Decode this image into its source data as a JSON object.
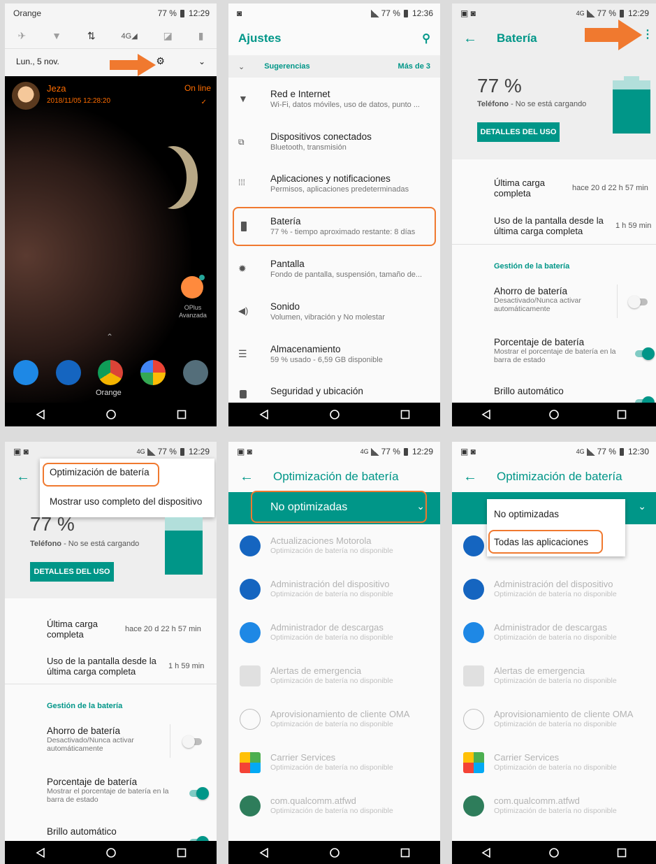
{
  "p1": {
    "carrier": "Orange",
    "battery": "77 %",
    "time": "12:29",
    "date": "Lun., 5 nov.",
    "notif_name": "Jeza",
    "notif_time": "2018/11/05 12:28:20",
    "notif_status": "On line",
    "app_label_1": "OPlus",
    "app_label_2": "Avanzada",
    "dock_label": "Orange"
  },
  "p2": {
    "time": "12:36",
    "battery": "77 %",
    "title": "Ajustes",
    "sugg_label": "Sugerencias",
    "sugg_more": "Más de 3",
    "items": [
      {
        "title": "Red e Internet",
        "sub": "Wi-Fi, datos móviles, uso de datos, punto ..."
      },
      {
        "title": "Dispositivos conectados",
        "sub": "Bluetooth, transmisión"
      },
      {
        "title": "Aplicaciones y notificaciones",
        "sub": "Permisos, aplicaciones predeterminadas"
      },
      {
        "title": "Batería",
        "sub": "77 % - tiempo aproximado restante: 8 días"
      },
      {
        "title": "Pantalla",
        "sub": "Fondo de pantalla, suspensión, tamaño de..."
      },
      {
        "title": "Sonido",
        "sub": "Volumen, vibración y No molestar"
      },
      {
        "title": "Almacenamiento",
        "sub": "59 % usado - 6,59 GB disponible"
      },
      {
        "title": "Seguridad y ubicación",
        "sub": ""
      }
    ]
  },
  "bat": {
    "time": "12:29",
    "battery": "77 %",
    "title": "Batería",
    "percent": "77 %",
    "phone_label": "Teléfono",
    "phone_status": " - No se está cargando",
    "details_btn": "DETALLES DEL USO",
    "last_charge_label": "Última carga completa",
    "last_charge_value": "hace 20 d 22 h 57 min",
    "screen_use_label": "Uso de la pantalla desde la última carga completa",
    "screen_use_value": "1 h 59 min",
    "section": "Gestión de la batería",
    "saver_title": "Ahorro de batería",
    "saver_sub": "Desactivado/Nunca activar automáticamente",
    "pct_title": "Porcentaje de batería",
    "pct_sub": "Mostrar el porcentaje de batería en la barra de estado",
    "bright_title": "Brillo automático",
    "level_fraction": 0.77
  },
  "p4": {
    "menu_1": "Optimización de batería",
    "menu_2": "Mostrar uso completo del dispositivo"
  },
  "opt": {
    "time_a": "12:29",
    "time_b": "12:30",
    "battery": "77 %",
    "title": "Optimización de batería",
    "filter": "No optimizadas",
    "drop_1": "No optimizadas",
    "drop_2": "Todas las aplicaciones",
    "apps": [
      {
        "name": "Actualizaciones Motorola",
        "sub": "Optimización de batería no disponible"
      },
      {
        "name": "Administración del dispositivo",
        "sub": "Optimización de batería no disponible"
      },
      {
        "name": "Administrador de descargas",
        "sub": "Optimización de batería no disponible"
      },
      {
        "name": "Alertas de emergencia",
        "sub": "Optimización de batería no disponible"
      },
      {
        "name": "Aprovisionamiento de cliente OMA",
        "sub": "Optimización de batería no disponible"
      },
      {
        "name": "Carrier Services",
        "sub": "Optimización de batería no disponible"
      },
      {
        "name": "com.qualcomm.atfwd",
        "sub": "Optimización de batería no disponible"
      }
    ]
  },
  "colors": {
    "accent": "#009688",
    "highlight": "#f0792f",
    "notif": "#ff6d00"
  }
}
